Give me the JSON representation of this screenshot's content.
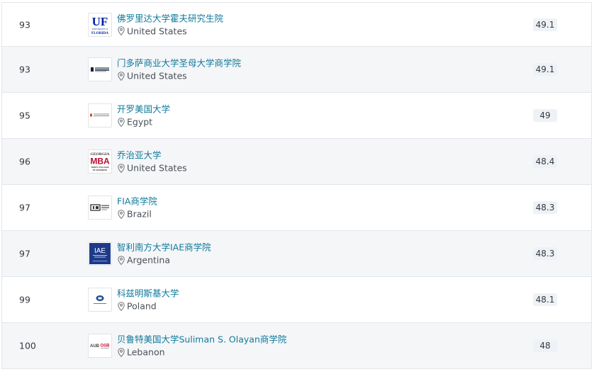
{
  "rankings": [
    {
      "rank": "93",
      "name": "佛罗里达大学霍夫研究生院",
      "country": "United States",
      "score": "49.1",
      "logo": "uf-logo"
    },
    {
      "rank": "93",
      "name": "门多萨商业大学圣母大学商学院",
      "country": "United States",
      "score": "49.1",
      "logo": "notre-dame-logo"
    },
    {
      "rank": "95",
      "name": "开罗美国大学",
      "country": "Egypt",
      "score": "49",
      "logo": "auc-logo"
    },
    {
      "rank": "96",
      "name": "乔治亚大学",
      "country": "United States",
      "score": "48.4",
      "logo": "georgia-mba-logo"
    },
    {
      "rank": "97",
      "name": "FIA商学院",
      "country": "Brazil",
      "score": "48.3",
      "logo": "fia-logo"
    },
    {
      "rank": "97",
      "name": "智利南方大学IAE商学院",
      "country": "Argentina",
      "score": "48.3",
      "logo": "iae-logo"
    },
    {
      "rank": "99",
      "name": "科兹明斯基大学",
      "country": "Poland",
      "score": "48.1",
      "logo": "kozminski-logo"
    },
    {
      "rank": "100",
      "name": "贝鲁特美国大学Suliman S. Olayan商学院",
      "country": "Lebanon",
      "score": "48",
      "logo": "aub-osb-logo"
    }
  ],
  "logo_text": {
    "uf_mark": "UF",
    "uf_sub": "UNIVERSITY of",
    "uf_state": "FLORIDA",
    "georgia_top": "GEORGIA",
    "georgia_mba": "MBA",
    "georgia_bottom": "TERRY COLLEGE OF BUSINESS",
    "iae": "IAE",
    "osb": "OSB"
  },
  "colors": {
    "link": "#117a9b",
    "row_alt": "#f5f6f8",
    "score_bg": "#eef2f6",
    "uf_blue": "#0021a5",
    "georgia_red": "#ba0c2f",
    "iae_blue": "#1d3a8a",
    "osb_red": "#c8102e"
  }
}
